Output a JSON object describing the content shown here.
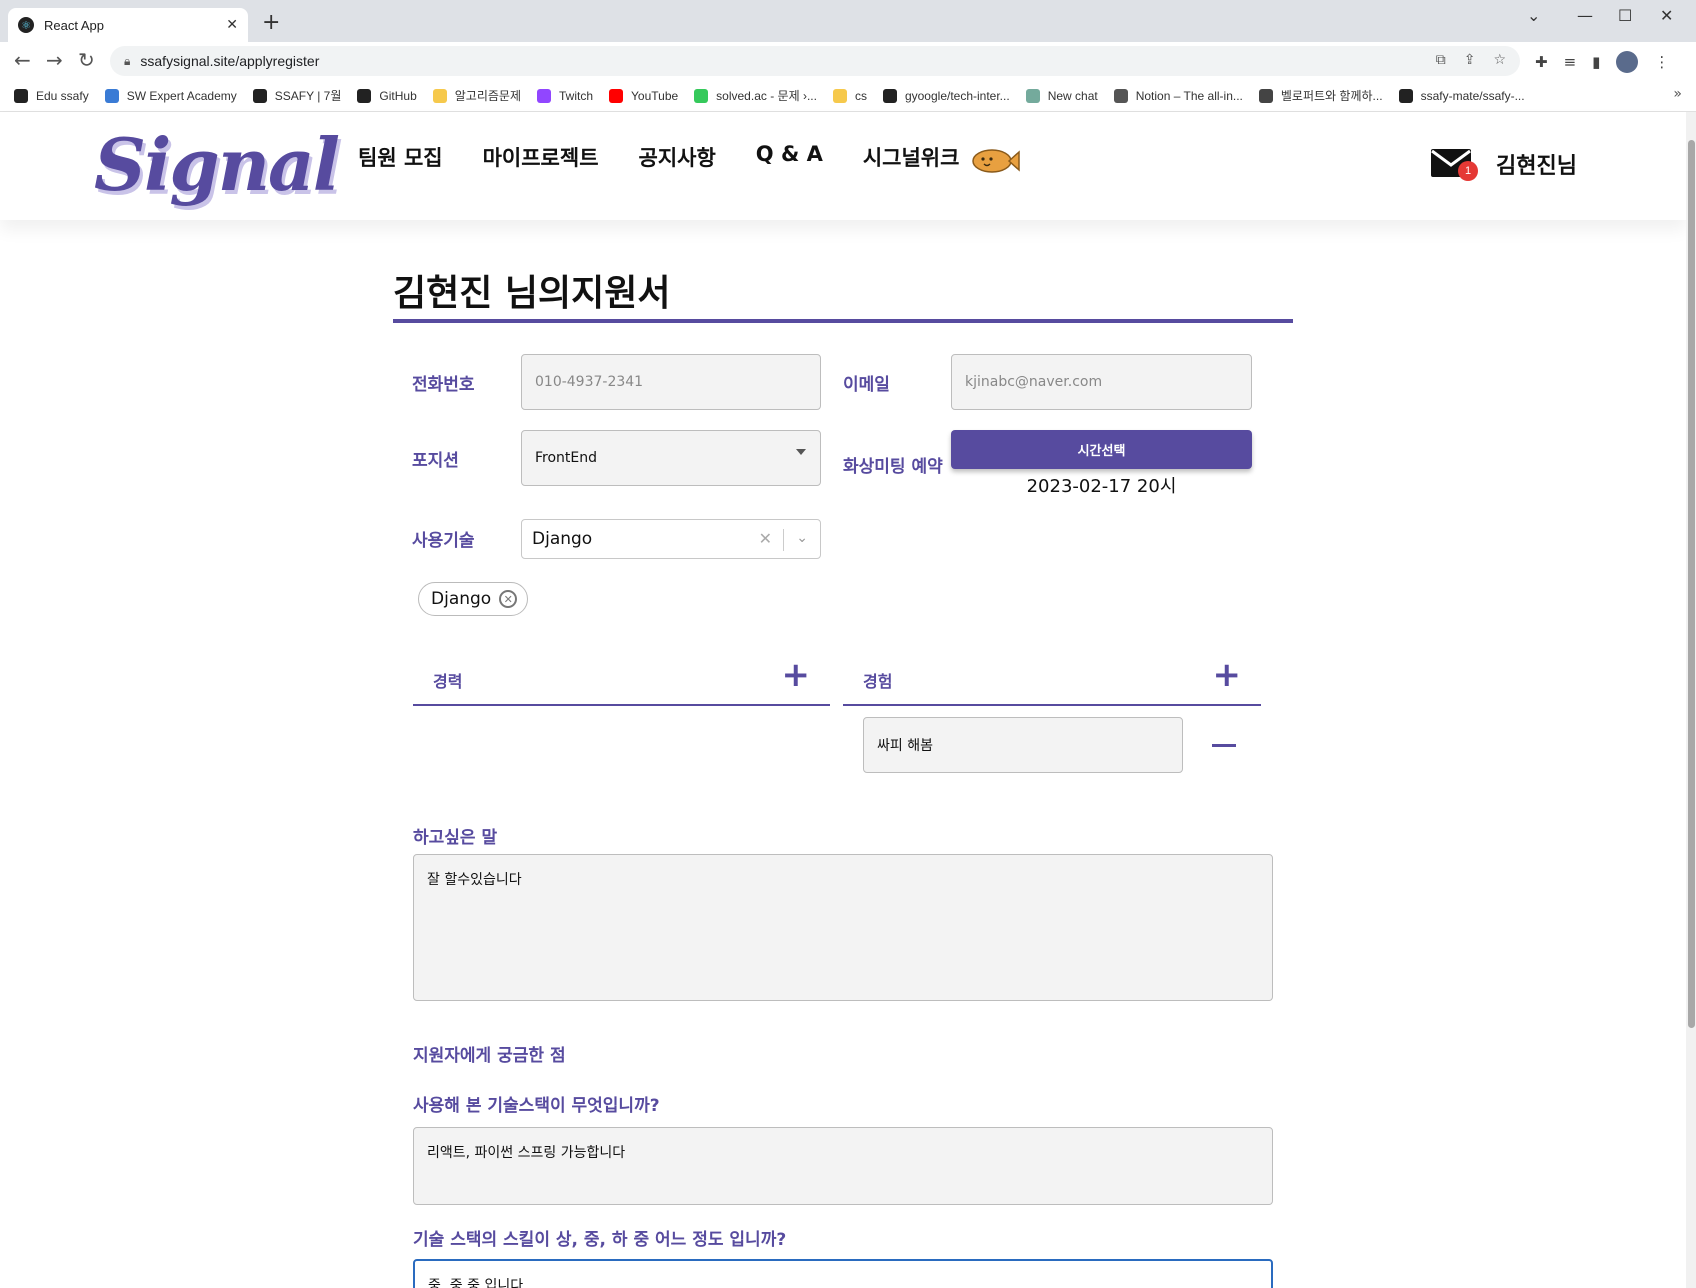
{
  "browser": {
    "tab_title": "React App",
    "url": "ssafysignal.site/applyregister",
    "bookmarks": [
      {
        "label": "Edu ssafy",
        "color": "#222222"
      },
      {
        "label": "SW Expert Academy",
        "color": "#3a7bd5"
      },
      {
        "label": "SSAFY | 7월",
        "color": "#222222"
      },
      {
        "label": "GitHub",
        "color": "#222222"
      },
      {
        "label": "알고리즘문제",
        "color": "#f6c94c"
      },
      {
        "label": "Twitch",
        "color": "#9146ff"
      },
      {
        "label": "YouTube",
        "color": "#ff0000"
      },
      {
        "label": "solved.ac - 문제 ›...",
        "color": "#35c95b"
      },
      {
        "label": "cs",
        "color": "#f6c94c"
      },
      {
        "label": "gyoogle/tech-inter...",
        "color": "#222222"
      },
      {
        "label": "New chat",
        "color": "#74aa9c"
      },
      {
        "label": "Notion – The all-in...",
        "color": "#555555"
      },
      {
        "label": "벨로퍼트와 함께하...",
        "color": "#444444"
      },
      {
        "label": "ssafy-mate/ssafy-...",
        "color": "#222222"
      }
    ]
  },
  "header": {
    "logo": "Signal",
    "menu": [
      "팀원 모집",
      "마이프로젝트",
      "공지사항",
      "Q & A",
      "시그널위크"
    ],
    "notification_count": "1",
    "user_name": "김현진님"
  },
  "form": {
    "title": "김현진 님의지원서",
    "phone_label": "전화번호",
    "phone_placeholder": "010-4937-2341",
    "email_label": "이메일",
    "email_placeholder": "kjinabc@naver.com",
    "position_label": "포지션",
    "position_value": "FrontEnd",
    "meeting_label": "화상미팅 예약",
    "time_button": "시간선택",
    "meeting_time": "2023-02-17 20시",
    "skill_label": "사용기술",
    "skill_select_value": "Django",
    "skill_chip": "Django",
    "career_label": "경력",
    "experience_label": "경험",
    "experience_item": "싸피 해봄",
    "message_label": "하고싶은 말",
    "message_value": "잘 할수있습니다",
    "questions_title": "지원자에게 궁금한 점",
    "q1": "사용해 본 기술스택이 무엇입니까?",
    "a1": "리액트, 파이썬 스프링 가능합니다",
    "q2": "기술 스택의 스킬이 상, 중, 하 중 어느 정도 입니까?",
    "a2": "중, 중 중 입니다"
  },
  "colors": {
    "accent": "#574b9f",
    "badge": "#e53935"
  }
}
